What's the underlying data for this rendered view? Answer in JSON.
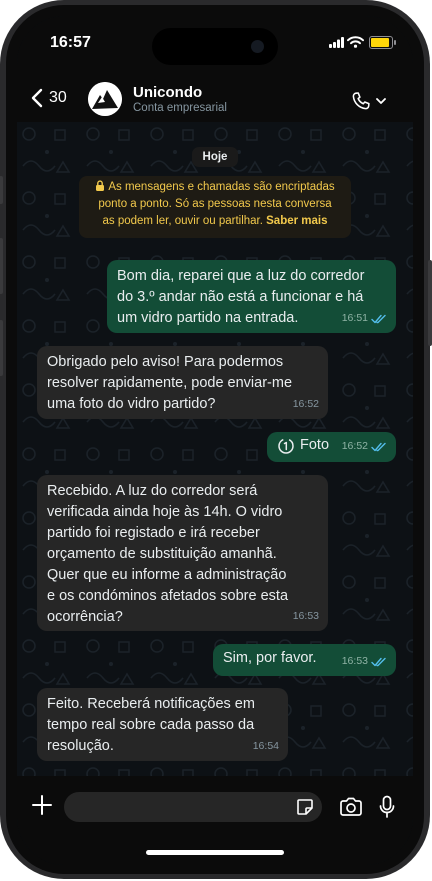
{
  "status_bar": {
    "time": "16:57",
    "battery_level": 0.95
  },
  "header": {
    "back_count": "30",
    "contact_name": "Unicondo",
    "contact_subtitle": "Conta empresarial"
  },
  "chat": {
    "date_label": "Hoje",
    "encryption_notice": {
      "line1": "As mensagens e chamadas são encriptadas",
      "line2": "ponto a ponto. Só as pessoas nesta conversa",
      "line3_text": "as podem ler, ouvir ou partilhar. ",
      "learn_more": "Saber mais"
    },
    "messages": [
      {
        "direction": "out",
        "lines": [
          "Bom dia, reparei que a luz do corredor",
          "do 3.º andar não está a funcionar e há",
          "um vidro partido na entrada."
        ],
        "time": "16:51",
        "status": "read"
      },
      {
        "direction": "in",
        "lines": [
          "Obrigado pelo aviso! Para podermos",
          "resolver rapidamente, pode enviar-me",
          "uma foto do vidro partido?"
        ],
        "time": "16:52"
      },
      {
        "direction": "out",
        "lines": [
          "Foto"
        ],
        "time": "16:52",
        "status": "read",
        "view_once": true
      },
      {
        "direction": "in",
        "lines": [
          "Recebido. A luz do corredor será",
          "verificada ainda hoje às 14h. O vidro",
          "partido foi registado e irá receber",
          "orçamento de substituição amanhã.",
          "Quer que eu informe a administração",
          "e os condóminos afetados sobre esta",
          "ocorrência?"
        ],
        "time": "16:53"
      },
      {
        "direction": "out",
        "lines": [
          "Sim, por favor."
        ],
        "time": "16:53",
        "status": "read"
      },
      {
        "direction": "in",
        "lines": [
          "Feito. Receberá notificações em",
          "tempo real sobre cada passo da",
          "resolução."
        ],
        "time": "16:54"
      }
    ]
  },
  "composer": {
    "input_value": ""
  },
  "colors": {
    "outgoing_bubble": "#134d37",
    "incoming_bubble": "#262626",
    "read_ticks": "#53bdeb",
    "notice_text": "#f2c94c"
  },
  "icons": [
    "back-chevron-icon",
    "whatsapp-business-avatar",
    "phone-icon",
    "chevron-down-icon",
    "lock-icon",
    "view-once-icon",
    "double-check-icon",
    "plus-icon",
    "sticker-icon",
    "camera-icon",
    "mic-icon"
  ]
}
